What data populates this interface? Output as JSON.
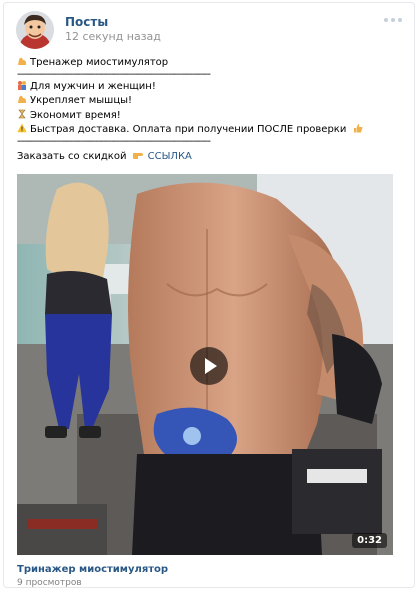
{
  "post": {
    "author": "Посты",
    "time": "12 секунд назад",
    "title_line": "Тренажер миостимулятор",
    "separator": "--------------------------------------------------------------------------",
    "bullets": [
      {
        "icon": "couple-icon",
        "text": "Для мужчин и женщин!"
      },
      {
        "icon": "muscle-icon",
        "text": "Укрепляет мышцы!"
      },
      {
        "icon": "hourglass-icon",
        "text": "Экономит время!"
      },
      {
        "icon": "warning-icon",
        "text": "Быстрая доставка. Оплата при получении ПОСЛЕ проверки"
      }
    ],
    "order_text": "Заказать со скидкой",
    "order_link": "ССЫЛКА"
  },
  "video": {
    "duration": "0:32",
    "title": "Тринажер миостимулятор",
    "views": "9 просмотров"
  },
  "colors": {
    "link": "#2a5885",
    "meta": "#939393",
    "muscle_emoji": "#f2b04a",
    "warning_emoji": "#f6c12d",
    "couple_emoji": "#e46b4c"
  }
}
